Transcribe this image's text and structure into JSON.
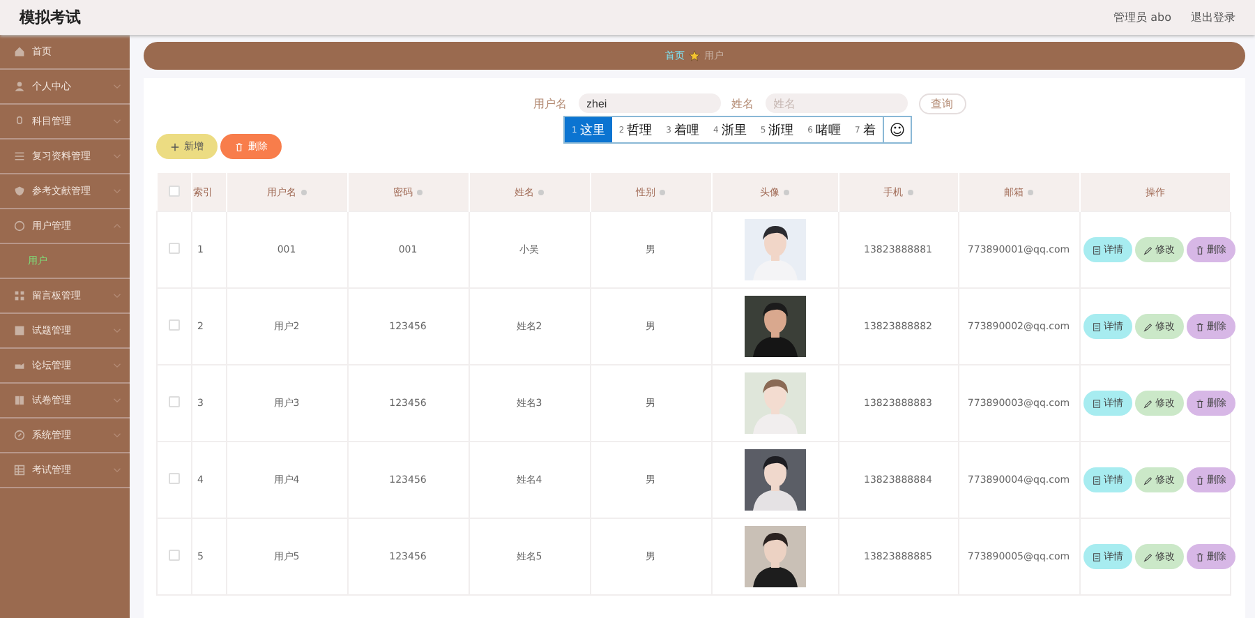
{
  "header": {
    "title": "模拟考试",
    "user": "管理员 abo",
    "logout": "退出登录"
  },
  "sidebar": {
    "items": [
      {
        "label": "首页"
      },
      {
        "label": "个人中心",
        "expanded": false
      },
      {
        "label": "科目管理",
        "expanded": false
      },
      {
        "label": "复习资料管理",
        "expanded": false
      },
      {
        "label": "参考文献管理",
        "expanded": false
      },
      {
        "label": "用户管理",
        "expanded": true,
        "children": [
          {
            "label": "用户",
            "selected": true
          }
        ]
      },
      {
        "label": "留言板管理",
        "expanded": false
      },
      {
        "label": "试题管理",
        "expanded": false
      },
      {
        "label": "论坛管理",
        "expanded": false
      },
      {
        "label": "试卷管理",
        "expanded": false
      },
      {
        "label": "系统管理",
        "expanded": false
      },
      {
        "label": "考试管理",
        "expanded": false
      }
    ]
  },
  "breadcrumb": [
    {
      "label": "首页",
      "selected": false
    },
    {
      "label": "用户",
      "selected": true
    }
  ],
  "search": {
    "fields": [
      {
        "label": "用户名",
        "value": "zhei"
      },
      {
        "label": "姓名",
        "placeholder": "姓名"
      }
    ],
    "button": "查询"
  },
  "ime": {
    "candidates": [
      {
        "index": "1",
        "text": "这里",
        "selected": true
      },
      {
        "index": "2",
        "text": "哲理",
        "selected": false
      },
      {
        "index": "3",
        "text": "着哩",
        "selected": false
      },
      {
        "index": "4",
        "text": "浙里",
        "selected": false
      },
      {
        "index": "5",
        "text": "浙理",
        "selected": false
      },
      {
        "index": "6",
        "text": "啫喱",
        "selected": false
      },
      {
        "index": "7",
        "text": "着",
        "selected": false
      }
    ],
    "emoji": "☺"
  },
  "actions": {
    "add": "新增",
    "delete": "删除"
  },
  "table": {
    "all_checked": false,
    "columns": [
      {
        "label": "索引",
        "sortable": false
      },
      {
        "label": "用户名",
        "sortable": true
      },
      {
        "label": "密码",
        "sortable": true
      },
      {
        "label": "姓名",
        "sortable": true
      },
      {
        "label": "性别",
        "sortable": true
      },
      {
        "label": "头像",
        "sortable": true
      },
      {
        "label": "手机",
        "sortable": true
      },
      {
        "label": "邮箱",
        "sortable": true
      },
      {
        "label": "操作",
        "sortable": false
      }
    ],
    "rows": [
      {
        "checked": false,
        "index": "1",
        "username": "001",
        "password": "001",
        "name": "小吴",
        "gender": "男",
        "phone": "13823888881",
        "email": "773890001@qq.com",
        "buttons": {
          "detail": "详情",
          "edit": "修改",
          "delete": "删除"
        }
      },
      {
        "checked": false,
        "index": "2",
        "username": "用户2",
        "password": "123456",
        "name": "姓名2",
        "gender": "男",
        "phone": "13823888882",
        "email": "773890002@qq.com",
        "buttons": {
          "detail": "详情",
          "edit": "修改",
          "delete": "删除"
        }
      },
      {
        "checked": false,
        "index": "3",
        "username": "用户3",
        "password": "123456",
        "name": "姓名3",
        "gender": "男",
        "phone": "13823888883",
        "email": "773890003@qq.com",
        "buttons": {
          "detail": "详情",
          "edit": "修改",
          "delete": "删除"
        }
      },
      {
        "checked": false,
        "index": "4",
        "username": "用户4",
        "password": "123456",
        "name": "姓名4",
        "gender": "男",
        "phone": "13823888884",
        "email": "773890004@qq.com",
        "buttons": {
          "detail": "详情",
          "edit": "修改",
          "delete": "删除"
        }
      },
      {
        "checked": false,
        "index": "5",
        "username": "用户5",
        "password": "123456",
        "name": "姓名5",
        "gender": "男",
        "phone": "13823888885",
        "email": "773890005@qq.com",
        "buttons": {
          "detail": "详情",
          "edit": "修改",
          "delete": "删除"
        }
      }
    ]
  }
}
